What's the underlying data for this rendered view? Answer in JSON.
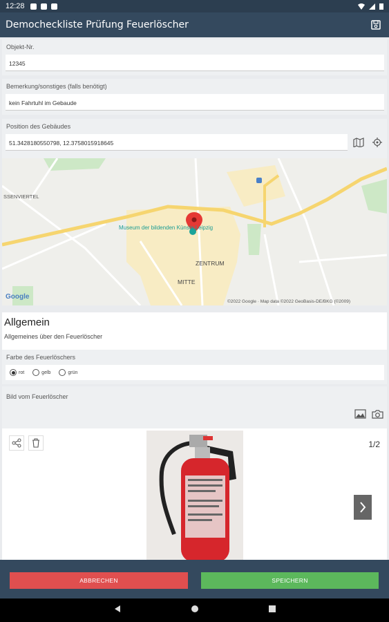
{
  "status": {
    "time": "12:28"
  },
  "app": {
    "title": "Democheckliste Prüfung Feuerlöscher"
  },
  "fields": {
    "objekt": {
      "label": "Objekt-Nr.",
      "value": "12345"
    },
    "bemerkung": {
      "label": "Bemerkung/sonstiges (falls benötigt)",
      "value": "kein Fahrtuhl im Gebaude"
    },
    "position": {
      "label": "Position des Gebäudes",
      "value": "51.3428180550798, 12.3758015918645"
    }
  },
  "map": {
    "labels": {
      "museum": "Museum der bildenden Künste Leipzig",
      "zentrum": "ZENTRUM",
      "mitte": "MITTE",
      "viertel": "SSENVIERTEL",
      "google": "Google",
      "attribution": "©2022 Google · Map data ©2022 GeoBasis-DE/BKG (©2009)"
    }
  },
  "section": {
    "title": "Allgemein",
    "subtitle": "Allgemeines über den Feuerlöscher"
  },
  "farbe": {
    "label": "Farbe des Feuerlöschers",
    "options": [
      {
        "label": "rot",
        "selected": true
      },
      {
        "label": "gelb",
        "selected": false
      },
      {
        "label": "grün",
        "selected": false
      }
    ]
  },
  "bild": {
    "label": "Bild vom Feuerlöscher",
    "counter": "1/2"
  },
  "buttons": {
    "cancel": "ABBRECHEN",
    "save": "SPEICHERN"
  },
  "colors": {
    "cancel": "#e04f4f",
    "save": "#5cb85c",
    "appbar": "#34495e"
  }
}
